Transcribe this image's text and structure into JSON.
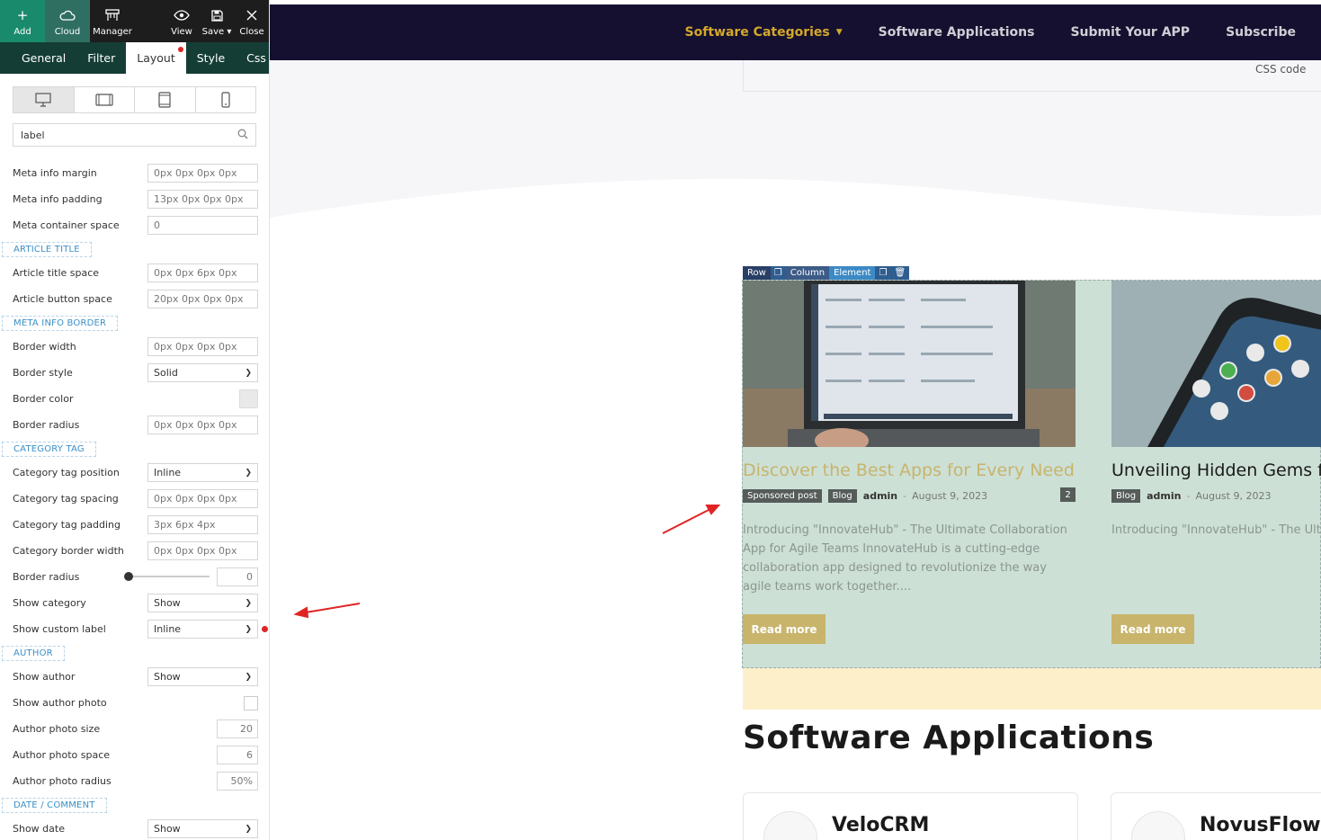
{
  "toolbar": {
    "add": "Add",
    "cloud": "Cloud",
    "manager": "Manager",
    "view": "View",
    "save": "Save",
    "close": "Close"
  },
  "tabs": [
    "General",
    "Filter",
    "Layout",
    "Style",
    "Css"
  ],
  "search": {
    "value": "label"
  },
  "fields": {
    "meta_info_margin": {
      "label": "Meta info margin",
      "value": "0px 0px 0px 0px"
    },
    "meta_info_padding": {
      "label": "Meta info padding",
      "value": "13px 0px 0px 0px"
    },
    "meta_container_space": {
      "label": "Meta container space",
      "value": "0"
    },
    "article_title_section": "ARTICLE TITLE",
    "article_title_space": {
      "label": "Article title space",
      "value": "0px 0px 6px 0px"
    },
    "article_button_space": {
      "label": "Article button space",
      "value": "20px 0px 0px 0px"
    },
    "meta_border_section": "META INFO BORDER",
    "border_width": {
      "label": "Border width",
      "value": "0px 0px 0px 0px"
    },
    "border_style": {
      "label": "Border style",
      "value": "Solid"
    },
    "border_color": {
      "label": "Border color",
      "color": "#e9e9e9"
    },
    "border_radius": {
      "label": "Border radius",
      "value": "0px 0px 0px 0px"
    },
    "category_section": "CATEGORY TAG",
    "category_tag_position": {
      "label": "Category tag position",
      "value": "Inline"
    },
    "category_tag_spacing": {
      "label": "Category tag spacing",
      "value": "0px 0px 0px 0px"
    },
    "category_tag_padding": {
      "label": "Category tag padding",
      "value": "3px 6px 4px"
    },
    "category_border_width": {
      "label": "Category border width",
      "value": "0px 0px 0px 0px"
    },
    "cat_border_radius": {
      "label": "Border radius",
      "value": "0"
    },
    "show_category": {
      "label": "Show category",
      "value": "Show"
    },
    "show_custom_label": {
      "label": "Show custom label",
      "value": "Inline"
    },
    "author_section": "AUTHOR",
    "show_author": {
      "label": "Show author",
      "value": "Show"
    },
    "show_author_photo": {
      "label": "Show author photo"
    },
    "author_photo_size": {
      "label": "Author photo size",
      "value": "20"
    },
    "author_photo_space": {
      "label": "Author photo space",
      "value": "6"
    },
    "author_photo_radius": {
      "label": "Author photo radius",
      "value": "50%"
    },
    "date_section": "DATE / COMMENT",
    "show_date": {
      "label": "Show date",
      "value": "Show"
    }
  },
  "nav": [
    "Software Categories",
    "Software Applications",
    "Submit Your APP",
    "Subscribe"
  ],
  "css_code": "CSS code",
  "editbar": {
    "row": "Row",
    "column": "Column",
    "element": "Element"
  },
  "posts": [
    {
      "title": "Discover the Best Apps for Every Need",
      "tags": [
        "Sponsored post",
        "Blog"
      ],
      "author": "admin",
      "date": "August 9, 2023",
      "comments": "2",
      "excerpt": "Introducing \"InnovateHub\" - The Ultimate Collaboration App for Agile Teams InnovateHub is a cutting-edge collaboration app designed to revolutionize the way agile teams work together....",
      "button": "Read more"
    },
    {
      "title": "Unveiling Hidden Gems fo",
      "tags": [
        "Blog"
      ],
      "author": "admin",
      "date": "August 9, 2023",
      "excerpt": "Introducing \"InnovateHub\" - The Ultim... for Agile Teams InnovateHub is a cuttin... app designed to revolutionize the way... together....",
      "button": "Read more"
    }
  ],
  "apps_heading": "Software Applications",
  "apps": [
    "VeloCRM",
    "NovusFlow"
  ],
  "colors": {
    "accent": "#d4a82c",
    "topbar": "#15102f",
    "section_bg": "#cde0d6",
    "readmore": "#c8b46b"
  }
}
